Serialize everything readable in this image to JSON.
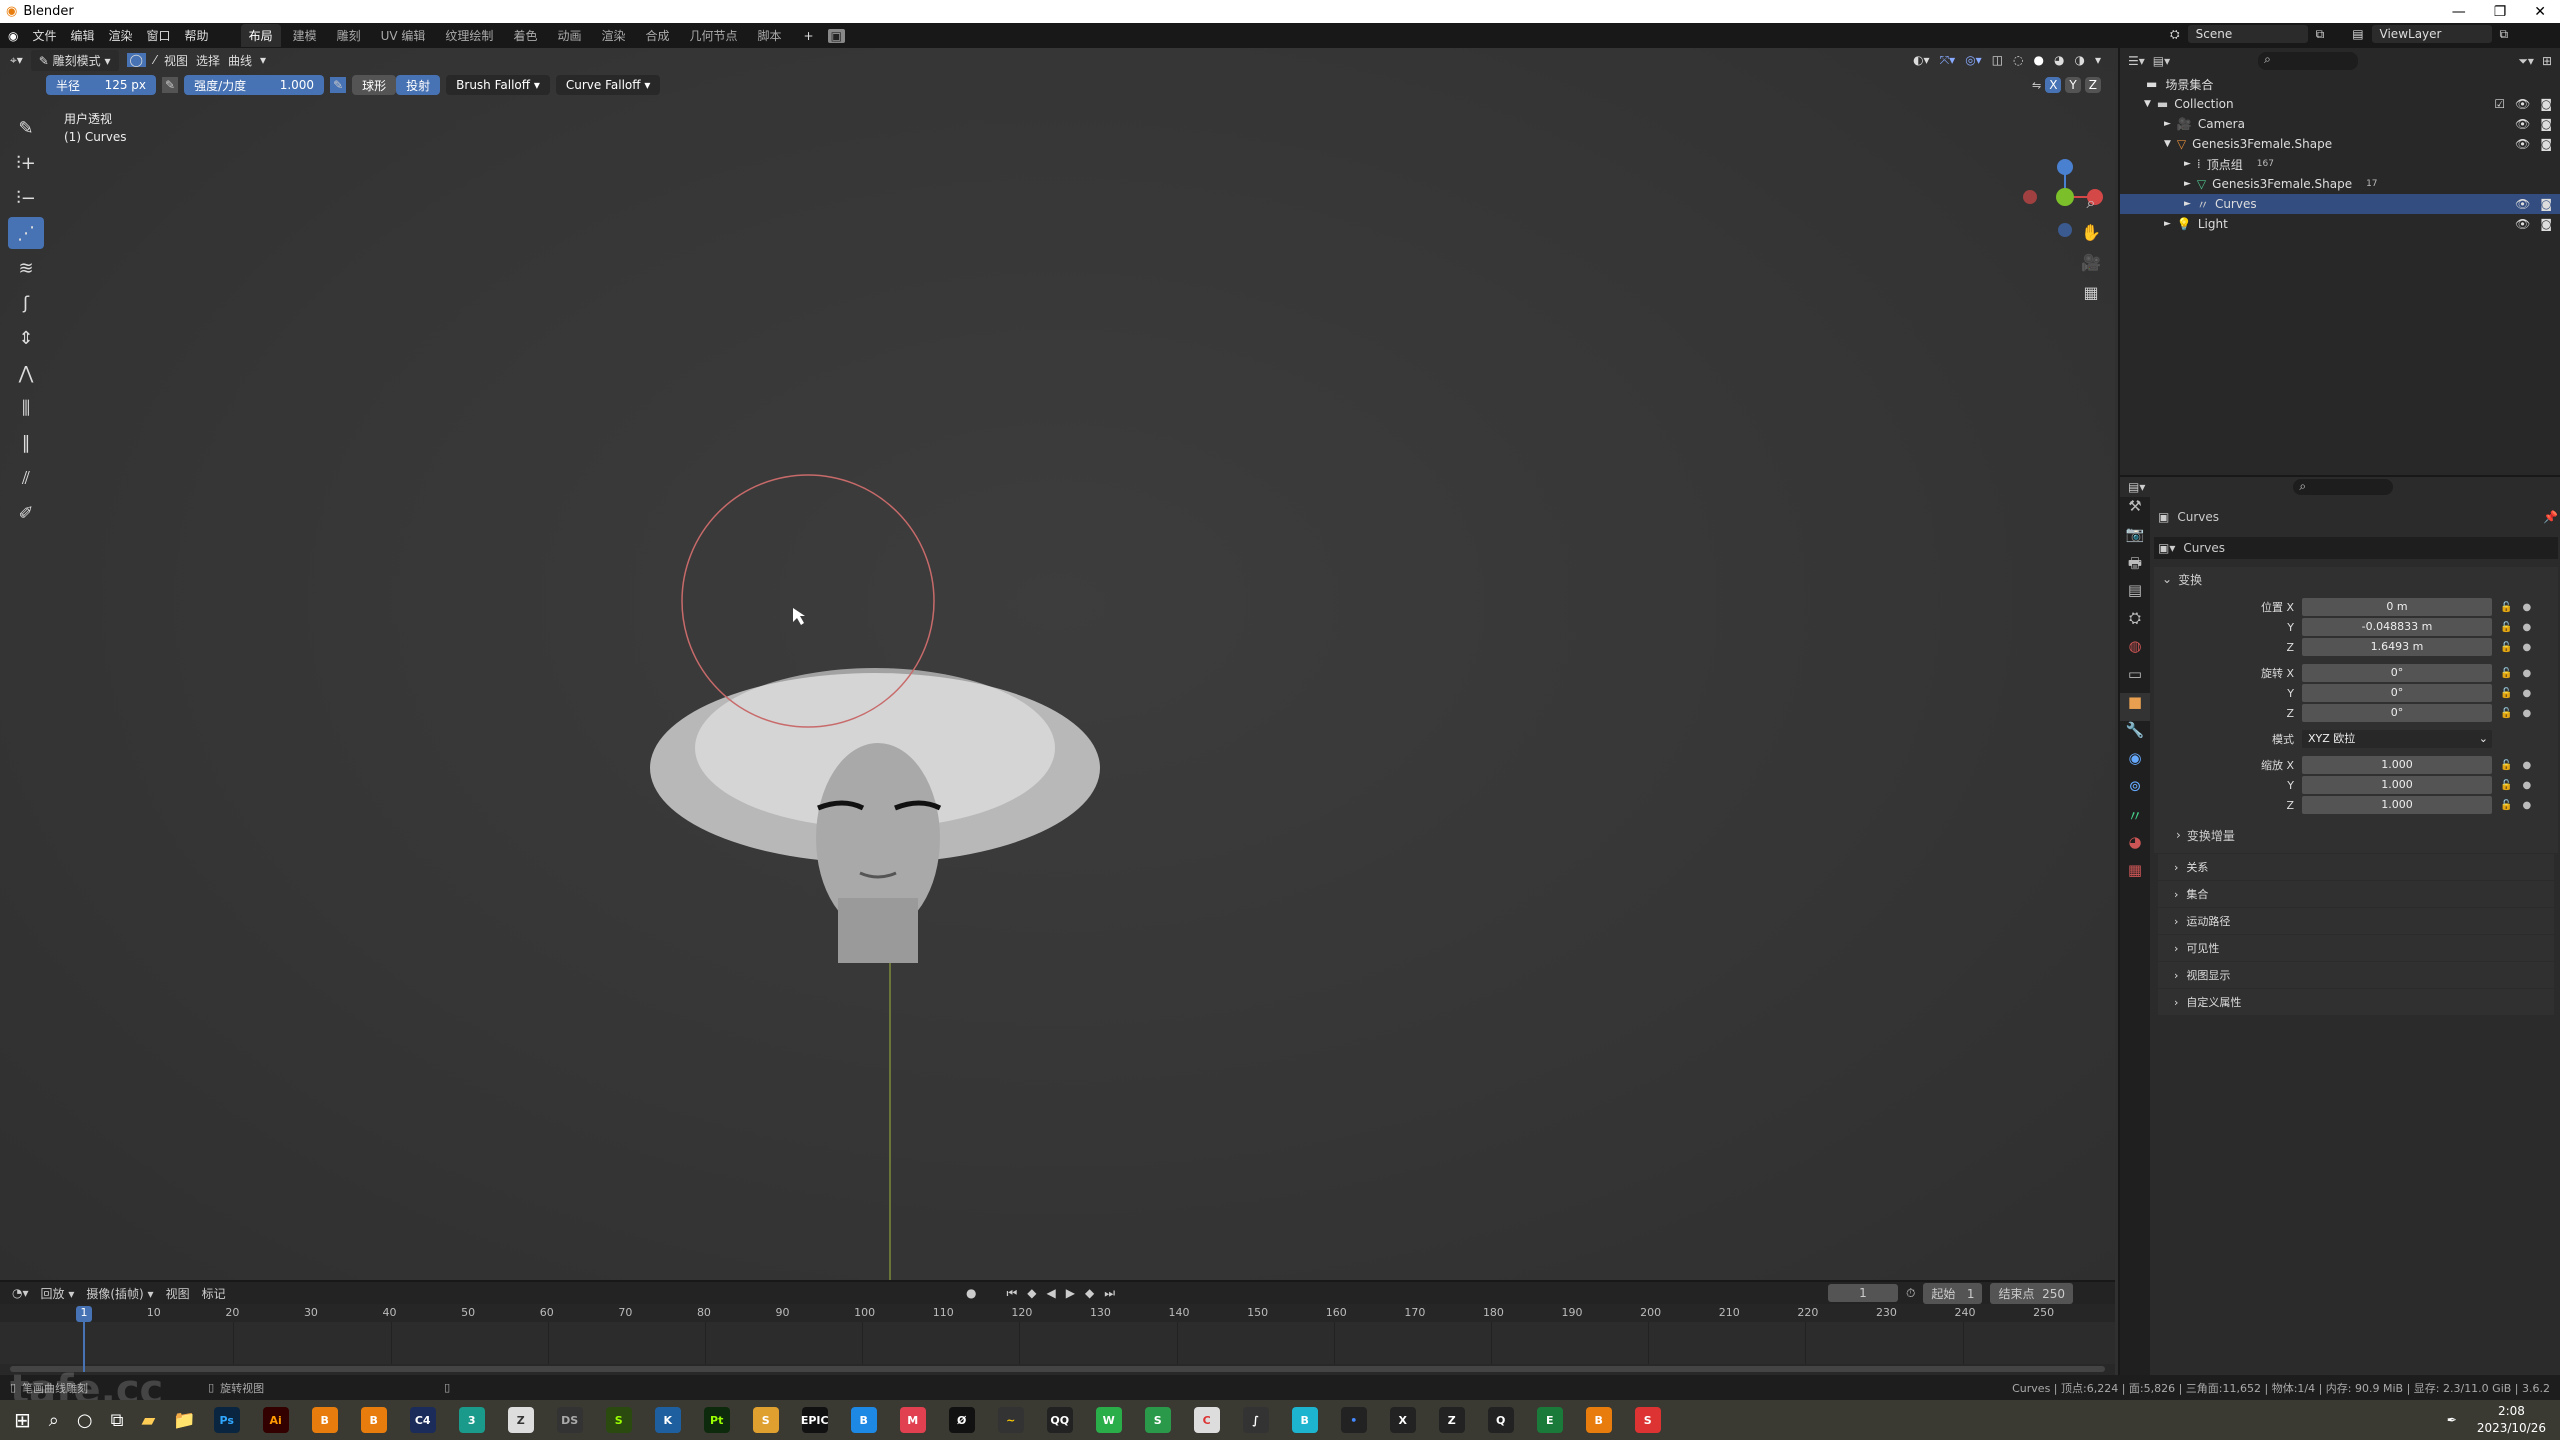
{
  "window": {
    "title": "Blender",
    "controls": [
      "—",
      "❐",
      "✕"
    ]
  },
  "menubar": {
    "menus": [
      "文件",
      "编辑",
      "渲染",
      "窗口",
      "帮助"
    ],
    "workspaces": [
      "布局",
      "建模",
      "雕刻",
      "UV 编辑",
      "纹理绘制",
      "着色",
      "动画",
      "渲染",
      "合成",
      "几何节点",
      "脚本"
    ],
    "active_workspace": "布局",
    "add": "+"
  },
  "viewport_header": {
    "mode": "雕刻模式",
    "menus": [
      "视图",
      "选择",
      "曲线"
    ]
  },
  "tool_settings": {
    "radius_label": "半径",
    "radius_value": "125 px",
    "strength_label": "强度/力度",
    "strength_value": "1.000",
    "sphere": "球形",
    "projected": "投射",
    "brush_falloff": "Brush Falloff",
    "curve_falloff": "Curve Falloff"
  },
  "viewport": {
    "view_name": "用户透视",
    "object_info": "(1) Curves",
    "axes": [
      "X",
      "Y",
      "Z"
    ]
  },
  "toolbar": {
    "tools": [
      "brush",
      "add",
      "delete",
      "density",
      "comb",
      "snake-hook",
      "grow-shrink",
      "pinch",
      "puff",
      "smooth",
      "slide",
      "annotate"
    ],
    "active_index": 3
  },
  "topbar_right": {
    "scene": "Scene",
    "view_layer": "ViewLayer"
  },
  "outliner": {
    "root": "场景集合",
    "items": [
      {
        "label": "Collection",
        "indent": 0,
        "expanded": true,
        "icon": "collection-icon",
        "color": "#cccccc"
      },
      {
        "label": "Camera",
        "indent": 1,
        "icon": "camera-icon",
        "color": "#e08a3a"
      },
      {
        "label": "Genesis3Female.Shape",
        "indent": 1,
        "expanded": true,
        "icon": "mesh-object-icon",
        "color": "#e08a3a"
      },
      {
        "label": "顶点组",
        "indent": 2,
        "icon": "vertex-group-icon",
        "badge": "167",
        "color": "#cccccc"
      },
      {
        "label": "Genesis3Female.Shape",
        "indent": 2,
        "icon": "mesh-data-icon",
        "badge": "17",
        "color": "#4fc08a"
      },
      {
        "label": "Curves",
        "indent": 2,
        "icon": "curves-icon",
        "selected": true,
        "color": "#cccccc"
      },
      {
        "label": "Light",
        "indent": 1,
        "icon": "light-icon",
        "color": "#e08a3a"
      }
    ]
  },
  "properties": {
    "object_name": "Curves",
    "data_name": "Curves",
    "panel": "变换",
    "location": {
      "label": "位置 X",
      "x": "0 m",
      "y": "-0.048833 m",
      "z": "1.6493 m"
    },
    "rotation": {
      "label": "旋转 X",
      "x": "0°",
      "y": "0°",
      "z": "0°"
    },
    "mode": {
      "label": "模式",
      "value": "XYZ 欧拉"
    },
    "scale": {
      "label": "缩放 X",
      "x": "1.000",
      "y": "1.000",
      "z": "1.000"
    },
    "axis_y": "Y",
    "axis_z": "Z",
    "delta": "变换增量",
    "sections": [
      "关系",
      "集合",
      "运动路径",
      "可见性",
      "视图显示",
      "自定义属性"
    ]
  },
  "timeline": {
    "menus": [
      "回放",
      "摄像(插帧)",
      "视图",
      "标记"
    ],
    "current_frame": "1",
    "start_label": "起始",
    "start": "1",
    "end_label": "结束点",
    "end": "250",
    "ticks": [
      "10",
      "20",
      "30",
      "40",
      "50",
      "60",
      "70",
      "80",
      "90",
      "100",
      "110",
      "120",
      "130",
      "140",
      "150",
      "160",
      "170",
      "180",
      "190",
      "200",
      "210",
      "220",
      "230",
      "240",
      "250"
    ]
  },
  "statusbar": {
    "left": "笔画曲线雕刻",
    "middle": "旋转视图",
    "stats": "Curves | 顶点:6,224 | 面:5,826 | 三角面:11,652 | 物体:1/4 | 内存: 90.9 MiB | 显存: 2.3/11.0 GiB | 3.6.2"
  },
  "taskbar": {
    "time": "2:08",
    "date": "2023/10/26",
    "apps": [
      {
        "n": "Ps",
        "c": "#0a2540",
        "t": "#31a8ff"
      },
      {
        "n": "Ai",
        "c": "#330000",
        "t": "#ff9a00"
      },
      {
        "n": "B",
        "c": "#e87d0d",
        "t": "#fff"
      },
      {
        "n": "B",
        "c": "#e87d0d",
        "t": "#fff"
      },
      {
        "n": "C4",
        "c": "#1b2b5a",
        "t": "#fff"
      },
      {
        "n": "3",
        "c": "#1a9a8a",
        "t": "#fff"
      },
      {
        "n": "Z",
        "c": "#ddd",
        "t": "#333"
      },
      {
        "n": "DS",
        "c": "#333",
        "t": "#aaa"
      },
      {
        "n": "S",
        "c": "#2a4a10",
        "t": "#9f0"
      },
      {
        "n": "K",
        "c": "#1e5fa0",
        "t": "#fff"
      },
      {
        "n": "Pt",
        "c": "#0d2a0d",
        "t": "#9f0"
      },
      {
        "n": "S",
        "c": "#e0a030",
        "t": "#fff"
      },
      {
        "n": "EPIC",
        "c": "#111",
        "t": "#fff"
      },
      {
        "n": "B",
        "c": "#1e88e5",
        "t": "#fff"
      },
      {
        "n": "M",
        "c": "#e04050",
        "t": "#fff"
      },
      {
        "n": "Ø",
        "c": "#111",
        "t": "#fff"
      },
      {
        "n": "~",
        "c": "#333",
        "t": "#fc0"
      },
      {
        "n": "QQ",
        "c": "#222",
        "t": "#fff"
      },
      {
        "n": "W",
        "c": "#2aae4a",
        "t": "#fff"
      },
      {
        "n": "S",
        "c": "#2a9a4a",
        "t": "#fff"
      },
      {
        "n": "C",
        "c": "#ddd",
        "t": "#d33"
      },
      {
        "n": "∫",
        "c": "#333",
        "t": "#fff"
      },
      {
        "n": "B",
        "c": "#1db4d0",
        "t": "#fff"
      },
      {
        "n": "•",
        "c": "#222",
        "t": "#48f"
      },
      {
        "n": "X",
        "c": "#222",
        "t": "#fff"
      },
      {
        "n": "Z",
        "c": "#222",
        "t": "#fff"
      },
      {
        "n": "Q",
        "c": "#222",
        "t": "#fff"
      },
      {
        "n": "E",
        "c": "#1a7a3a",
        "t": "#fff"
      },
      {
        "n": "B",
        "c": "#e87d0d",
        "t": "#fff"
      },
      {
        "n": "S",
        "c": "#d33",
        "t": "#fff"
      }
    ]
  },
  "watermark": "tafe.cc",
  "colors": {
    "accent": "#4772b3",
    "selected_row": "#334d80",
    "x_axis": "#d54848",
    "y_axis": "#7bbf2a",
    "z_axis": "#4a80d0"
  }
}
